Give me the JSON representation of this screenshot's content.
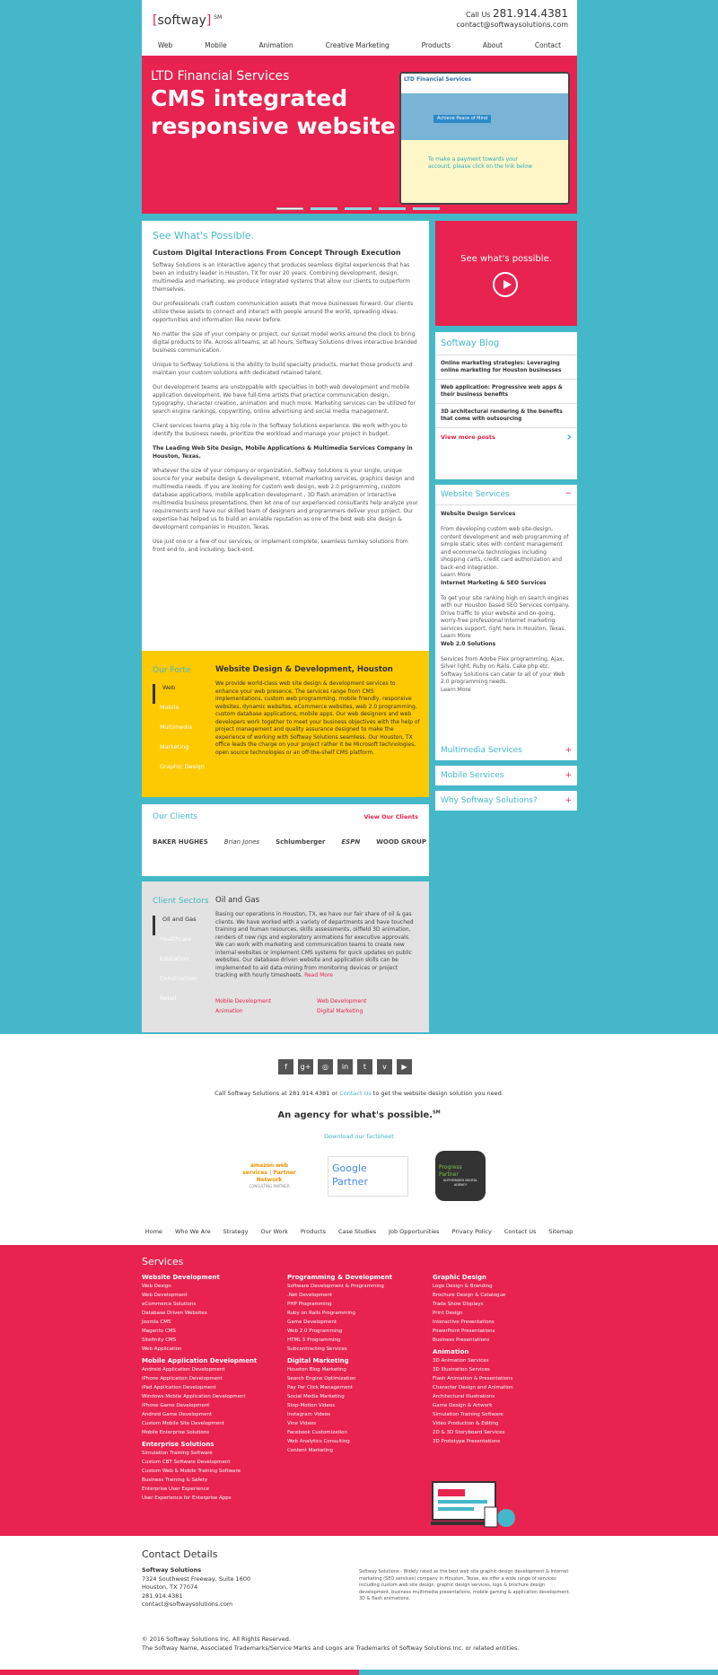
{
  "header": {
    "logo": "softway",
    "logo_mark": "SM",
    "call_label": "Call Us",
    "phone": "281.914.4381",
    "email": "contact@softwaysolutions.com",
    "nav": [
      "Web",
      "Mobile",
      "Animation",
      "Creative Marketing",
      "Products",
      "About",
      "Contact"
    ]
  },
  "hero": {
    "subtitle": "LTD Financial Services",
    "title": "CMS integrated responsive website",
    "screen_logo": "LTD Financial Services",
    "screen_tag": "Achieve Peace of Mind",
    "screen_text": "To make a payment towards your account, please click on the link below"
  },
  "main": {
    "heading": "See What's Possible.",
    "subheading": "Custom Digital Interactions From Concept Through Execution",
    "p1": "Softway Solutions is an interactive agency that produces seamless digital experiences that has been an industry leader in Houston, TX for over 20 years. Combining development, design, multimedia and marketing, we produce integrated systems that allow our clients to outperform themselves.",
    "p2": "Our professionals craft custom communication assets that move businesses forward. Our clients utilize these assets to connect and interact with people around the world, spreading ideas, opportunities and information like never before.",
    "p3": "No matter the size of your company or project, our sunset model works around the clock to bring digital products to life. Across all teams, at all hours, Softway Solutions drives interactive branded business communication.",
    "p4": "Unique to Softway Solutions is the ability to build specialty products, market those products and maintain your custom solutions with dedicated retained talent.",
    "p5": "Our development teams are unstoppable with specialties in both web development and mobile application development. We have full-time artists that practice communication design, typography, character creation, animation and much more. Marketing services can be utilized for search engine rankings, copywriting, online advertising and social media management.",
    "p6": "Client services teams play a big role in the Softway Solutions experience. We work with you to identify the business needs, prioritize the workload and manage your project in budget.",
    "p7": "The Leading Web Site Design, Mobile Applications & Multimedia Services Company in Houston, Texas.",
    "p8": "Whatever the size of your company or organization, Softway Solutions is your single, unique source for your website design & development, Internet marketing services, graphics design and multimedia needs. If you are looking for custom web design, web 2.0 programming, custom database applications, mobile application development , 3D flash animation or interactive multimedia business presentations, then let one of our experienced consultants help analyze your requirements and have our skilled team of designers and programmers deliver your project. Our expertise has helped us to build an enviable reputation as one of the best web site design & development companies in Houston, Texas.",
    "p9": "Use just one or a few of our services, or implement complete, seamless turnkey solutions from front end to, and including, back-end."
  },
  "video": {
    "label": "See what's possible."
  },
  "blog": {
    "heading": "Softway Blog",
    "posts": [
      "Online marketing strategies: Leveraging online marketing for Houston businesses",
      "Web application: Progressive web apps & their business benefits",
      "3D architectural rendering & the benefits that come with outsourcing"
    ],
    "more": "View more posts"
  },
  "accordion": {
    "web_title": "Website Services",
    "web_toggle": "−",
    "h1": "Website Design Services",
    "t1": "From developing custom web site-design, content development and web programming of simple static sites with content management and ecommerce technologies including shopping carts, credit card authorization and back-end integration.",
    "h2": "Internet Marketing & SEO Services",
    "t2": "To get your site ranking high on search engines with our Houston based SEO Services company. Drive traffic to your website and on-going, worry-free professional Internet marketing services support, right here in Houston, Texas.",
    "h3": "Web 2.0 Solutions",
    "t3": "Services from Adobe Flex programming, Ajax, Silver light, Ruby on Rails, Cake php etc. Softway Solutions can cater to all of your Web 2.0 programming needs.",
    "learn": "Learn More",
    "multimedia": "Multimedia Services",
    "mobile": "Mobile Services",
    "why": "Why Softway Solutions?",
    "plus": "+"
  },
  "forte": {
    "heading": "Our Forte",
    "items": [
      "Web",
      "Mobile",
      "Multimedia",
      "Marketing",
      "Graphic Design"
    ],
    "title": "Website Design & Development, Houston",
    "text": "We provide world-class web site design & development services to enhance your web presence. The services range from CMS implementations, custom web programming, mobile friendly, responsive websites, dynamic websites, eCommerce websites, web 2.0 programming, custom database applications, mobile apps. Our web designers and web developers work together to meet your business objectives with the help of project management and quality assurance designed to make the experience of working with Softway Solutions seamless. Our Houston, TX office leads the charge on your project rather it be Microsoft technologies, open source technologies or an off-the-shelf CMS platform."
  },
  "clients": {
    "heading": "Our Clients",
    "view": "View Our Clients",
    "logos": [
      "BAKER HUGHES",
      "Brian Jones",
      "Schlumberger",
      "ESPN",
      "WOOD GROUP"
    ]
  },
  "sectors": {
    "heading": "Client Sectors",
    "items": [
      "Oil and Gas",
      "Healthcare",
      "Education",
      "Construction",
      "Retail"
    ],
    "title": "Oil and Gas",
    "text": "Basing our operations in Houston, TX, we have our fair share of oil & gas clients. We have worked with a variety of departments and have touched training and human resources, skills assessments, oilfield 3D animation, renders of new rigs and exploratory animations for executive approvals. We can work with marketing and communication teams to create new internal websites or implement CMS systems for quick updates on public websites. Our database driven website and application skills can be implemented to aid data-mining from monitoring devices or project tracking with hourly timesheets.",
    "read": "Read More",
    "links": [
      "Mobile Development",
      "Web Development",
      "Animation",
      "Digital Marketing"
    ]
  },
  "footer": {
    "social": [
      "f",
      "g+",
      "◎",
      "in",
      "t",
      "v",
      "▶"
    ],
    "call_pre": "Call Softway Solutions at 281.914.4381 or",
    "call_link": "Contact Us",
    "call_post": "to get the website design solution you need.",
    "agency": "An agency for what's possible.",
    "agency_mark": "SM",
    "factsheet": "Download our factsheet",
    "badge1": "amazon web services | Partner Network",
    "badge1_sub": "CONSULTING PARTNER",
    "badge2": "Google Partner",
    "badge3": "Progress Partner",
    "badge3_sub": "AUTHORIZED DIGITAL AGENCY",
    "nav": [
      "Home",
      "Who We Are",
      "Strategy",
      "Our Work",
      "Products",
      "Case Studies",
      "Job Opportunities",
      "Privacy Policy",
      "Contact Us",
      "Sitemap"
    ]
  },
  "services": {
    "heading": "Services",
    "col1": [
      {
        "h": "Website Development",
        "items": [
          "Web Design",
          "Web Development",
          "eCommerce Solutions",
          "Database Driven Websites",
          "Joomla CMS",
          "Magento CMS",
          "Sitefinity CMS",
          "Web Application"
        ]
      },
      {
        "h": "Mobile Application Development",
        "items": [
          "Android Application Development",
          "iPhone Application Development",
          "iPad Application Development",
          "Windows Mobile Application Development",
          "iPhone Game Development",
          "Android Game Development",
          "Custom Mobile Site Development",
          "Mobile Enterprise Solutions"
        ]
      },
      {
        "h": "Enterprise Solutions",
        "items": [
          "Simulation Training Software",
          "Custom CBT Software Development",
          "Custom Web & Mobile Training Software",
          "Business Training & Safety",
          "Enterprise User Experience",
          "User Experience for Enterprise Apps"
        ]
      }
    ],
    "col2": [
      {
        "h": "Programming & Development",
        "items": [
          "Software Development & Programming",
          ".Net Development",
          "PHP Programming",
          "Ruby on Rails Programming",
          "Game Development",
          "Web 2.0 Programming",
          "HTML 5 Programming",
          "Subcontracting Services"
        ]
      },
      {
        "h": "Digital Marketing",
        "items": [
          "Houston Blog Marketing",
          "Search Engine Optimization",
          "Pay Per Click Management",
          "Social Media Marketing",
          "Stop-Motion Videos",
          "Instagram Videos",
          "Vine Videos",
          "Facebook Customization",
          "Web Analytics Consulting",
          "Content Marketing"
        ]
      }
    ],
    "col3": [
      {
        "h": "Graphic Design",
        "items": [
          "Logo Design & Branding",
          "Brochure Design & Catalogue",
          "Trade Show Displays",
          "Print Design",
          "Interactive Presentations",
          "PowerPoint Presentations",
          "Business Presentations"
        ]
      },
      {
        "h": "Animation",
        "items": [
          "3D Animation Services",
          "3D Illustration Services",
          "Flash Animation & Presentations",
          "Character Design and Animation",
          "Architectural Illustrations",
          "Game Design & Artwork",
          "Simulation Training Software",
          "Video Production & Editing",
          "2D & 3D Storyboard Services",
          "3D Prototype Presentations"
        ]
      }
    ]
  },
  "contact": {
    "heading": "Contact Details",
    "name": "Softway Solutions",
    "addr1": "7324 Southwest Freeway, Suite 1600",
    "addr2": "Houston, TX 77074",
    "phone": "281.914.4381",
    "email": "contact@softwaysolutions.com",
    "blurb": "Softway Solutions - Widely rated as the best web site graphic design development & Internet marketing (SEO services) company in Houston, Texas, we offer a wide range of services including custom web site design, graphic design services, logo & brochure design development, business multimedia presentations, mobile gaming & application development, 3D & flash animations.",
    "copy1": "© 2016 Softway Solutions Inc. All Rights Reserved.",
    "copy2": "The Softway Name, Associated Trademarks/Service Marks and Logos are Trademarks of Softway Solutions Inc. or related entities."
  },
  "colors": {
    "teal": "#44b8c9",
    "pink": "#e8234f",
    "yellow": "#fdc900",
    "grey": "#e2e2e2"
  }
}
